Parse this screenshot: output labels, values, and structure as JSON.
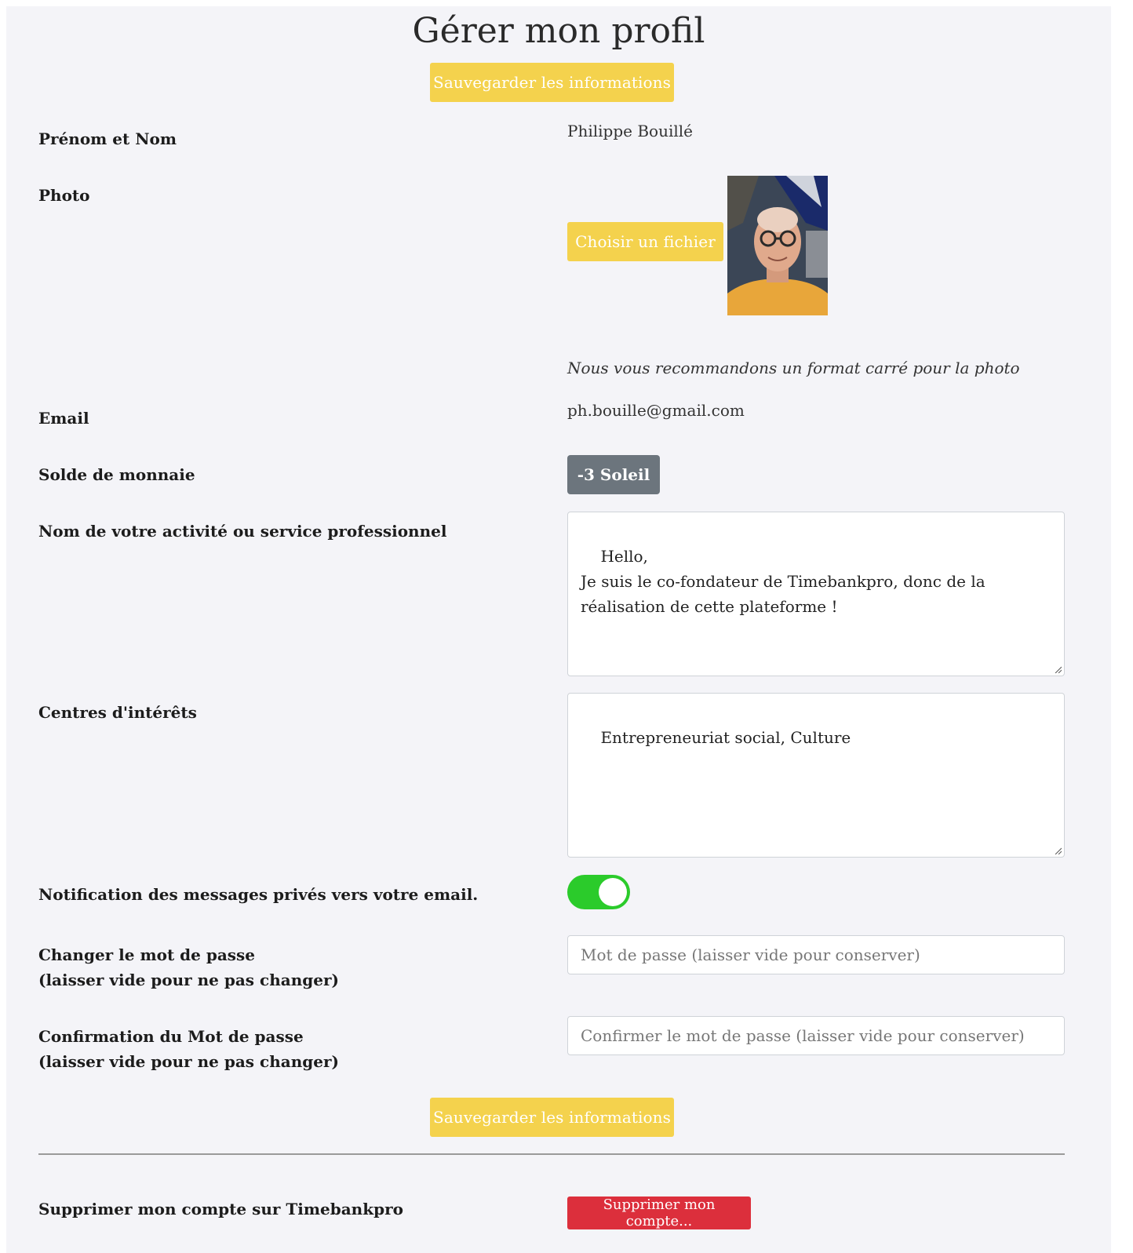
{
  "page": {
    "title": "Gérer mon profil",
    "save_button_top": "Sauvegarder les informations",
    "save_button_bottom": "Sauvegarder les informations"
  },
  "fields": {
    "name": {
      "label": "Prénom et Nom",
      "value": "Philippe Bouillé"
    },
    "photo": {
      "label": "Photo",
      "choose_file_label": "Choisir un fichier",
      "hint": "Nous vous recommandons un format carré pour la photo"
    },
    "email": {
      "label": "Email",
      "value": "ph.bouille@gmail.com"
    },
    "balance": {
      "label": "Solde de monnaie",
      "value": "-3 Soleil"
    },
    "activity": {
      "label": "Nom de votre activité ou service professionnel",
      "value": "Hello,\nJe suis le co-fondateur de Timebankpro, donc de la réalisation de cette plateforme !"
    },
    "interests": {
      "label": "Centres d'intérêts",
      "value": "Entrepreneuriat social, Culture"
    },
    "notification": {
      "label": "Notification des messages privés vers votre email.",
      "enabled": true
    },
    "password": {
      "label_line1": "Changer le mot de passe",
      "label_line2": "(laisser vide pour ne pas changer)",
      "placeholder": "Mot de passe (laisser vide pour conserver)"
    },
    "password_confirm": {
      "label_line1": "Confirmation du Mot de passe",
      "label_line2": "(laisser vide pour ne pas changer)",
      "placeholder": "Confirmer le mot de passe (laisser vide pour conserver)"
    }
  },
  "delete_account": {
    "label": "Supprimer mon compte sur Timebankpro",
    "button": "Supprimer mon compte..."
  },
  "colors": {
    "accent_yellow": "#f4d24d",
    "toggle_on": "#2bcb2b",
    "badge_gray": "#6c757d",
    "danger_red": "#dc2f3c"
  }
}
